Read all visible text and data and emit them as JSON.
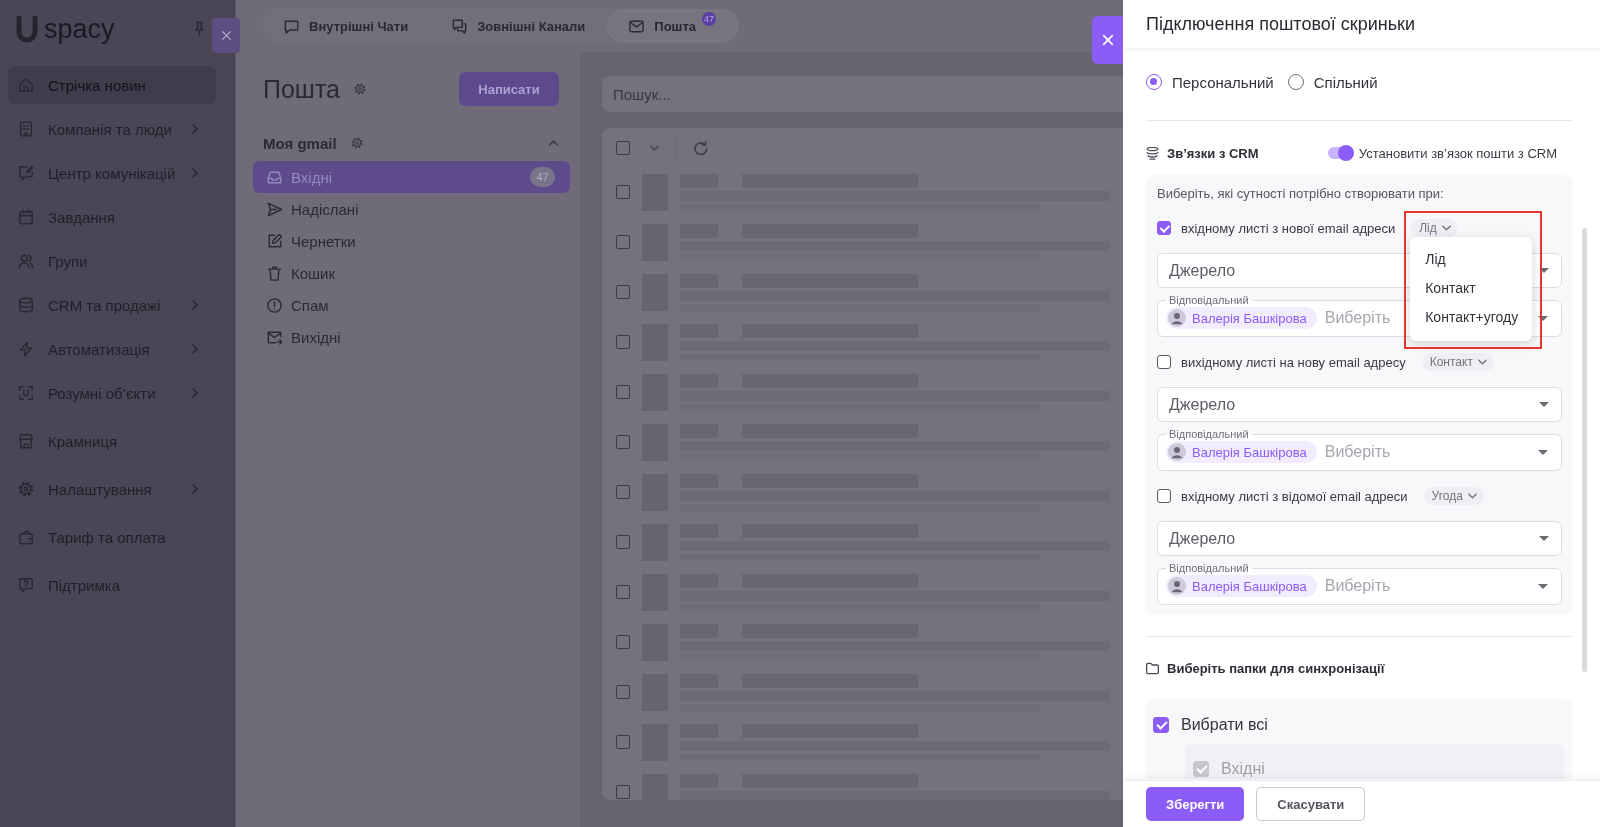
{
  "sidebar": {
    "logo": "spacy",
    "sections": [
      {
        "items": [
          {
            "label": "Стрічка новин",
            "selected": true,
            "expandable": false
          },
          {
            "label": "Компанія та люди",
            "selected": false,
            "expandable": true
          },
          {
            "label": "Центр комунікацій",
            "selected": false,
            "expandable": true
          },
          {
            "label": "Завдання",
            "selected": false,
            "expandable": false
          },
          {
            "label": "Групи",
            "selected": false,
            "expandable": false
          },
          {
            "label": "CRM та продажі",
            "selected": false,
            "expandable": true
          },
          {
            "label": "Автоматизація",
            "selected": false,
            "expandable": true
          },
          {
            "label": "Розумні об’єкти",
            "selected": false,
            "expandable": true
          }
        ]
      },
      {
        "items": [
          {
            "label": "Крамниця",
            "selected": false,
            "expandable": false
          }
        ]
      },
      {
        "items": [
          {
            "label": "Налаштування",
            "selected": false,
            "expandable": true
          }
        ]
      },
      {
        "items": [
          {
            "label": "Тариф та оплата",
            "selected": false,
            "expandable": false
          }
        ]
      },
      {
        "items": [
          {
            "label": "Підтримка",
            "selected": false,
            "expandable": false
          }
        ]
      }
    ]
  },
  "tabs": [
    {
      "label": "Внутрішні Чати",
      "selected": false
    },
    {
      "label": "Зовнішні Канали",
      "selected": false
    },
    {
      "label": "Пошта",
      "selected": true,
      "badge": "47"
    }
  ],
  "mail": {
    "title": "Пошта",
    "compose_button": "Написати",
    "account": {
      "name": "Моя gmail",
      "expanded": true
    },
    "folders": [
      {
        "label": "Вхідні",
        "selected": true,
        "badge": "47"
      },
      {
        "label": "Надіслані",
        "selected": false
      },
      {
        "label": "Чернетки",
        "selected": false
      },
      {
        "label": "Кошик",
        "selected": false
      },
      {
        "label": "Спам",
        "selected": false
      },
      {
        "label": "Вихідні",
        "selected": false
      }
    ],
    "search": {
      "placeholder": "Пошук..."
    },
    "select_all": {
      "checked": false
    },
    "rows": [
      {
        "checked": false
      },
      {
        "checked": false
      },
      {
        "checked": false
      },
      {
        "checked": false
      },
      {
        "checked": false
      },
      {
        "checked": false
      },
      {
        "checked": false
      },
      {
        "checked": false
      },
      {
        "checked": false
      },
      {
        "checked": false
      },
      {
        "checked": false
      },
      {
        "checked": false
      },
      {
        "checked": false
      }
    ]
  },
  "drawer": {
    "title": "Підключення поштової скриньки",
    "mailbox_types": [
      {
        "label": "Персональний",
        "selected": true
      },
      {
        "label": "Спільний",
        "selected": false
      }
    ],
    "crm": {
      "title": "Зв’язки з CRM",
      "link_toggle": {
        "label": "Установити зв’язок пошти з CRM",
        "on": true
      },
      "intro": "Виберіть, які сутності потрібно створювати при:",
      "rules": [
        {
          "label": "вхідному листі з нової email адреси",
          "checked": true,
          "entity": "Лід",
          "expanded": true,
          "highlighted": true,
          "options": [
            {
              "label": "Лід",
              "selected": false
            },
            {
              "label": "Контакт",
              "selected": false
            },
            {
              "label": "Контакт+угоду",
              "selected": false
            }
          ],
          "source": {
            "placeholder": "Джерело"
          },
          "responsible": {
            "label": "Відповідальний",
            "assignee": "Валерія Башкірова",
            "placeholder": "Виберіть"
          }
        },
        {
          "label": "вихідному листі на нову email адресу",
          "checked": false,
          "entity": "Контакт",
          "expanded": false,
          "highlighted": false,
          "source": {
            "placeholder": "Джерело"
          },
          "responsible": {
            "label": "Відповідальний",
            "assignee": "Валерія Башкірова",
            "placeholder": "Виберіть"
          }
        },
        {
          "label": "вхідному листі з відомої email адреси",
          "checked": false,
          "entity": "Угода",
          "expanded": false,
          "highlighted": false,
          "source": {
            "placeholder": "Джерело"
          },
          "responsible": {
            "label": "Відповідальний",
            "assignee": "Валерія Башкірова",
            "placeholder": "Виберіть"
          }
        }
      ]
    },
    "sync": {
      "title": "Виберіть папки для синхронізації",
      "select_all": {
        "label": "Вибрати всі",
        "checked": true
      },
      "folders": [
        {
          "label": "Вхідні",
          "checked": true,
          "disabled": true
        }
      ]
    },
    "buttons": [
      {
        "label": "Зберегти",
        "kind": "primary"
      },
      {
        "label": "Скасувати",
        "kind": "secondary"
      }
    ]
  }
}
